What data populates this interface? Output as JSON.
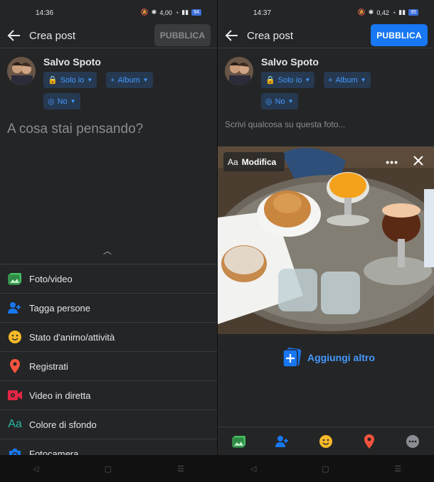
{
  "left": {
    "status": {
      "time": "14:36",
      "speed": "4,00",
      "battery": "94"
    },
    "header": {
      "title": "Crea post",
      "publish_label": "PUBBLICA"
    },
    "user": {
      "name": "Salvo Spoto"
    },
    "chips": {
      "privacy": "Solo io",
      "album": "Album",
      "instagram": "No"
    },
    "composer": {
      "placeholder": "A cosa stai pensando?"
    },
    "menu": [
      {
        "label": "Foto/video",
        "icon": "photo-icon"
      },
      {
        "label": "Tagga persone",
        "icon": "tag-people-icon"
      },
      {
        "label": "Stato d'animo/attività",
        "icon": "emoji-icon"
      },
      {
        "label": "Registrati",
        "icon": "location-pin-icon"
      },
      {
        "label": "Video in diretta",
        "icon": "live-video-icon"
      },
      {
        "label": "Colore di sfondo",
        "icon": "background-color-icon"
      },
      {
        "label": "Fotocamera",
        "icon": "camera-icon"
      }
    ]
  },
  "right": {
    "status": {
      "time": "14:37",
      "speed": "0,42",
      "battery": "95"
    },
    "header": {
      "title": "Crea post",
      "publish_label": "PUBBLICA"
    },
    "user": {
      "name": "Salvo Spoto"
    },
    "chips": {
      "privacy": "Solo io",
      "album": "Album",
      "instagram": "No"
    },
    "composer": {
      "placeholder": "Scrivi qualcosa su questa foto..."
    },
    "photo": {
      "edit_prefix": "Aa",
      "edit_label": "Modifica"
    },
    "add_more_label": "Aggiungi altro"
  },
  "colors": {
    "accent": "#1877f2",
    "link": "#4599ff",
    "background": "#242526"
  }
}
